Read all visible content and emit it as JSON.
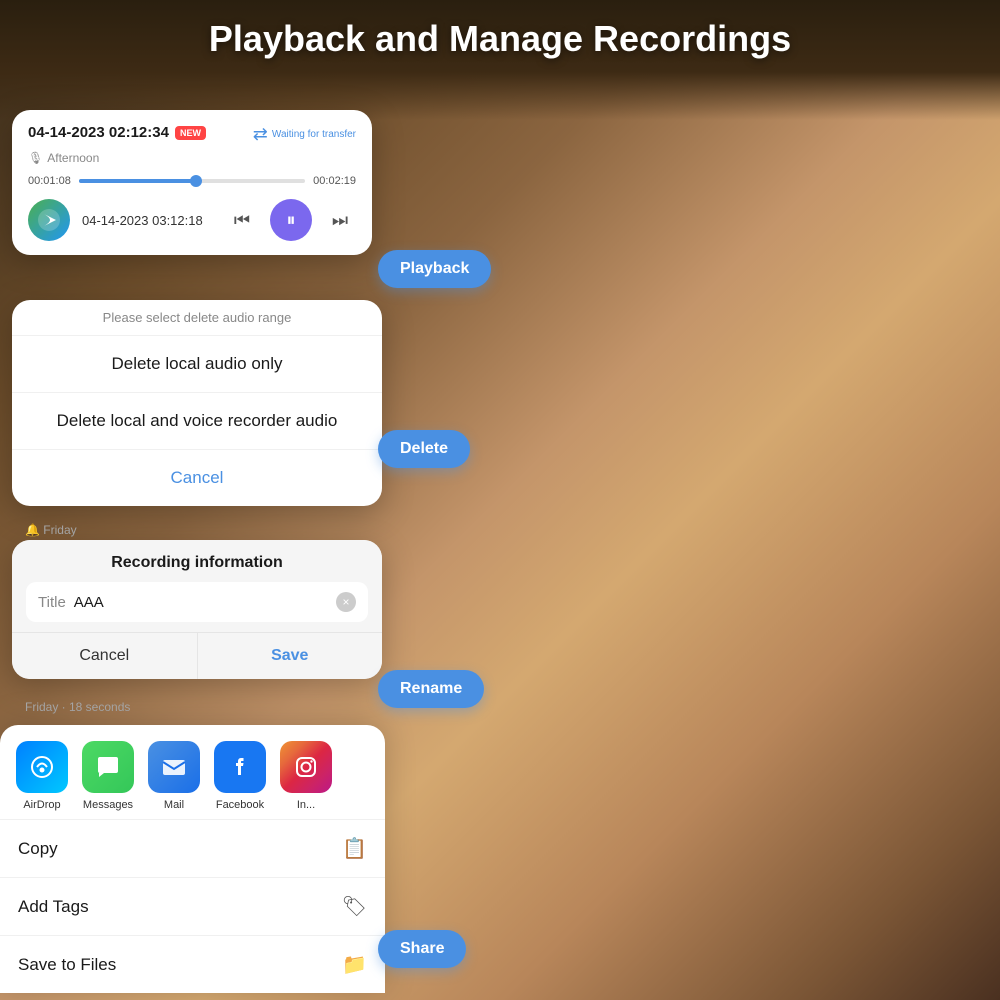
{
  "page": {
    "title": "Playback and Manage Recordings"
  },
  "playback_card": {
    "date": "04-14-2023 02:12:34",
    "badge": "NEW",
    "label": "Afternoon",
    "transfer_text": "Waiting for transfer",
    "time_start": "00:01:08",
    "time_end": "00:02:19",
    "recording_date2": "04-14-2023 03:12:18",
    "progress_percent": 50
  },
  "playback_bubble": {
    "label": "Playback"
  },
  "delete_card": {
    "hint": "Please select delete audio range",
    "option1": "Delete local audio only",
    "option2": "Delete local and voice recorder audio",
    "cancel": "Cancel"
  },
  "delete_bubble": {
    "label": "Delete"
  },
  "rename_card": {
    "title": "Recording information",
    "input_label": "Title",
    "input_value": "AAA",
    "cancel": "Cancel",
    "save": "Save"
  },
  "rename_bubble": {
    "label": "Rename"
  },
  "share_card": {
    "apps": [
      {
        "name": "AirDrop",
        "icon_class": "app-airdrop"
      },
      {
        "name": "Messages",
        "icon_class": "app-messages"
      },
      {
        "name": "Mail",
        "icon_class": "app-mail"
      },
      {
        "name": "Facebook",
        "icon_class": "app-facebook"
      },
      {
        "name": "In...",
        "icon_class": "app-instagram"
      }
    ],
    "list_items": [
      {
        "label": "Copy",
        "icon": "📋"
      },
      {
        "label": "Add Tags",
        "icon": "🏷"
      },
      {
        "label": "Save to Files",
        "icon": "📁"
      }
    ]
  },
  "share_bubble": {
    "label": "Share"
  },
  "friday_label": "🔔 Friday",
  "friday_label2": "Friday · 18 seconds"
}
